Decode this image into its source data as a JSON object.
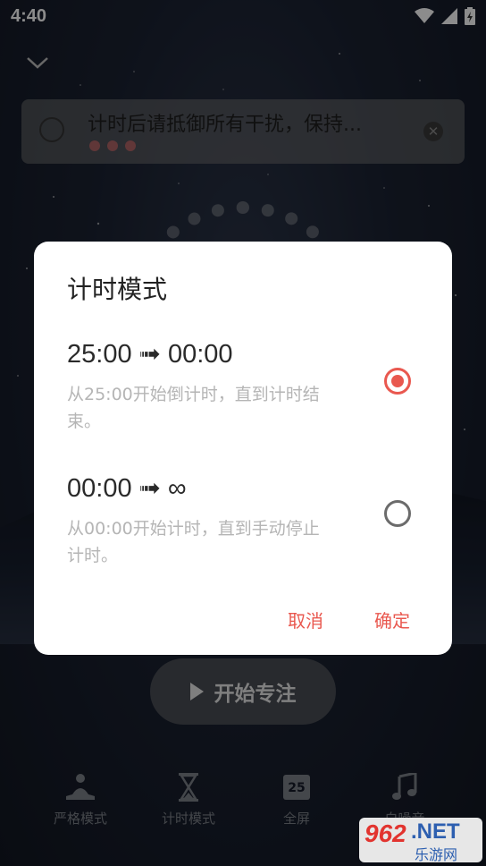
{
  "status_bar": {
    "time": "4:40"
  },
  "notice": {
    "text": "计时后请抵御所有干扰，保持..."
  },
  "dialog": {
    "title": "计时模式",
    "options": [
      {
        "title": "25:00 ➟ 00:00",
        "description": "从25:00开始倒计时，直到计时结束。",
        "selected": true
      },
      {
        "title": "00:00 ➟ ∞",
        "description": "从00:00开始计时，直到手动停止计时。",
        "selected": false
      }
    ],
    "cancel_label": "取消",
    "confirm_label": "确定"
  },
  "start_button": {
    "label": "开始专注"
  },
  "bottom_nav": {
    "items": [
      {
        "label": "严格模式",
        "icon": "meditation-icon"
      },
      {
        "label": "计时模式",
        "icon": "hourglass-icon"
      },
      {
        "label": "全屏",
        "icon": "calendar-icon",
        "icon_text": "25"
      },
      {
        "label": "白噪音",
        "icon": "music-note-icon"
      }
    ]
  },
  "watermark": {
    "number": "962",
    "net": ".NET",
    "sub": "乐游网"
  },
  "colors": {
    "accent": "#e9584f",
    "dialog_bg": "#ffffff",
    "desc_text": "#b5b5b5"
  }
}
